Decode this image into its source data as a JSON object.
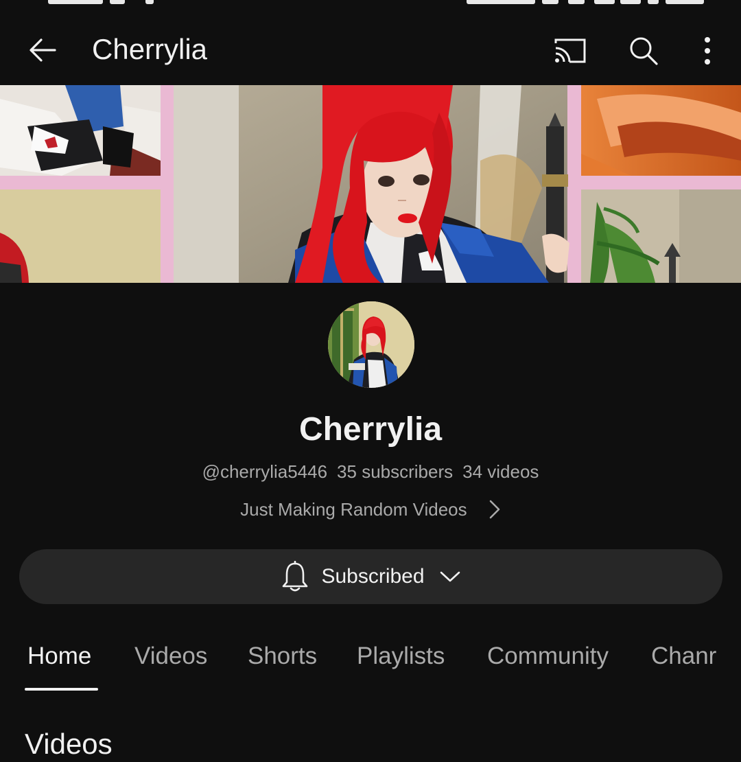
{
  "app_bar": {
    "title": "Cherrylia"
  },
  "icons": {
    "back": "arrow-left-icon",
    "cast": "cast-icon",
    "search": "search-icon",
    "more": "more-vertical-icon",
    "bell": "bell-icon",
    "description_chevron": "chevron-right-icon",
    "subscribe_dropdown": "chevron-down-icon"
  },
  "channel": {
    "name": "Cherrylia",
    "handle": "@cherrylia5446",
    "subscribers": "35 subscribers",
    "videos": "34 videos",
    "description": "Just Making Random Videos"
  },
  "subscribe_button": {
    "label": "Subscribed"
  },
  "tabs": [
    {
      "label": "Home",
      "active": true
    },
    {
      "label": "Videos",
      "active": false
    },
    {
      "label": "Shorts",
      "active": false
    },
    {
      "label": "Playlists",
      "active": false
    },
    {
      "label": "Community",
      "active": false
    },
    {
      "label": "Chanr",
      "active": false
    }
  ],
  "section": {
    "title": "Videos"
  },
  "colors": {
    "background": "#0f0f0f",
    "text_primary": "#f1f1f1",
    "text_secondary": "#aaaaaa",
    "button_bg": "#272727",
    "banner_frame": "#e9b9d2",
    "hair_red": "#d8141c"
  }
}
